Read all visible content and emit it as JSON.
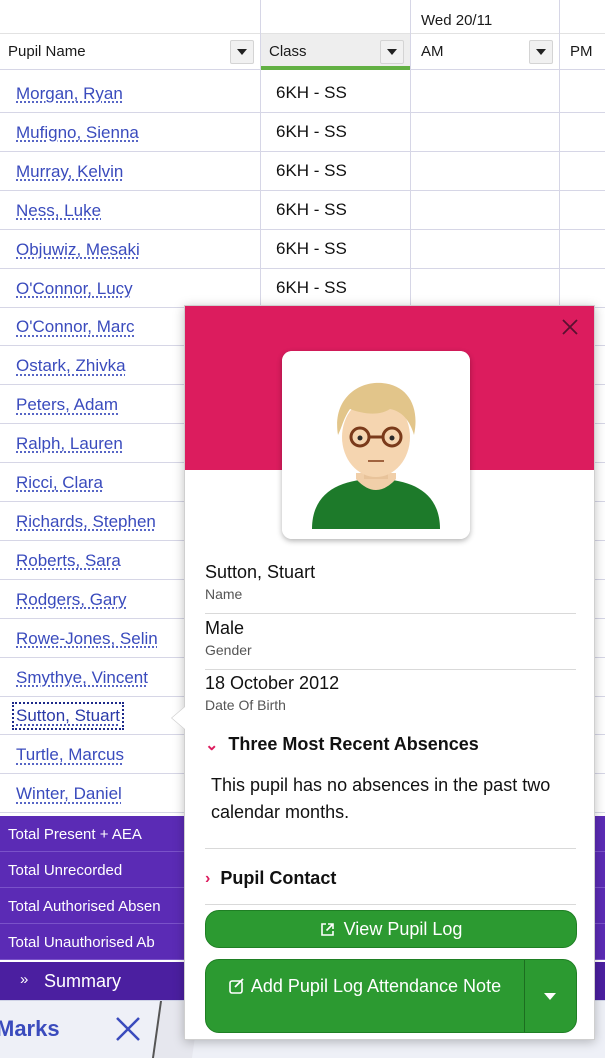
{
  "grid": {
    "date_header": "Wed 20/11",
    "columns": [
      {
        "label": "Pupil Name"
      },
      {
        "label": "Class"
      },
      {
        "label": "AM"
      },
      {
        "label": "PM"
      }
    ],
    "rows": [
      {
        "name": "Morgan, Ryan",
        "class": "6KH - SS"
      },
      {
        "name": "Mufigno, Sienna",
        "class": "6KH - SS"
      },
      {
        "name": "Murray, Kelvin",
        "class": "6KH - SS"
      },
      {
        "name": "Ness, Luke",
        "class": "6KH - SS"
      },
      {
        "name": "Objuwiz, Mesaki",
        "class": "6KH - SS"
      },
      {
        "name": "O'Connor, Lucy",
        "class": "6KH - SS"
      },
      {
        "name": "O'Connor, Marc",
        "class": ""
      },
      {
        "name": "Ostark, Zhivka",
        "class": ""
      },
      {
        "name": "Peters, Adam",
        "class": ""
      },
      {
        "name": "Ralph, Lauren",
        "class": ""
      },
      {
        "name": "Ricci, Clara",
        "class": ""
      },
      {
        "name": "Richards, Stephen",
        "class": ""
      },
      {
        "name": "Roberts, Sara",
        "class": ""
      },
      {
        "name": "Rodgers, Gary",
        "class": ""
      },
      {
        "name": "Rowe-Jones, Selin",
        "class": ""
      },
      {
        "name": "Smythye, Vincent",
        "class": ""
      },
      {
        "name": "Sutton, Stuart",
        "class": ""
      },
      {
        "name": "Turtle, Marcus",
        "class": ""
      },
      {
        "name": "Winter, Daniel",
        "class": ""
      }
    ],
    "focused_row": "Sutton, Stuart"
  },
  "totals": [
    {
      "label": "Total Present + AEA"
    },
    {
      "label": "Total Unrecorded"
    },
    {
      "label": "Total Authorised Absen"
    },
    {
      "label": "Total Unauthorised Ab"
    }
  ],
  "summary": {
    "label": "Summary",
    "icon": "double-chevron-down-icon"
  },
  "bottom_bar": {
    "tab_label": "Marks",
    "close_icon": "close-icon"
  },
  "popover": {
    "banner_color": "#dc1c5e",
    "close_icon": "close-icon",
    "avatar_icon": "pupil-avatar-icon",
    "fields": [
      {
        "value": "Sutton, Stuart",
        "label": "Name"
      },
      {
        "value": "Male",
        "label": "Gender"
      },
      {
        "value": "18 October 2012",
        "label": "Date Of Birth"
      }
    ],
    "absences": {
      "heading": "Three Most Recent Absences",
      "text": "This pupil has no absences in the past two calendar months."
    },
    "contact": {
      "heading": "Pupil Contact"
    },
    "buttons": {
      "view_log": "View Pupil Log",
      "add_note": "Add Pupil Log Attendance Note"
    },
    "button_color": "#2c9a31"
  },
  "colors": {
    "link": "#3a4bbd",
    "totals_bg": "#5b2bb5",
    "accent_green": "#62b043"
  }
}
